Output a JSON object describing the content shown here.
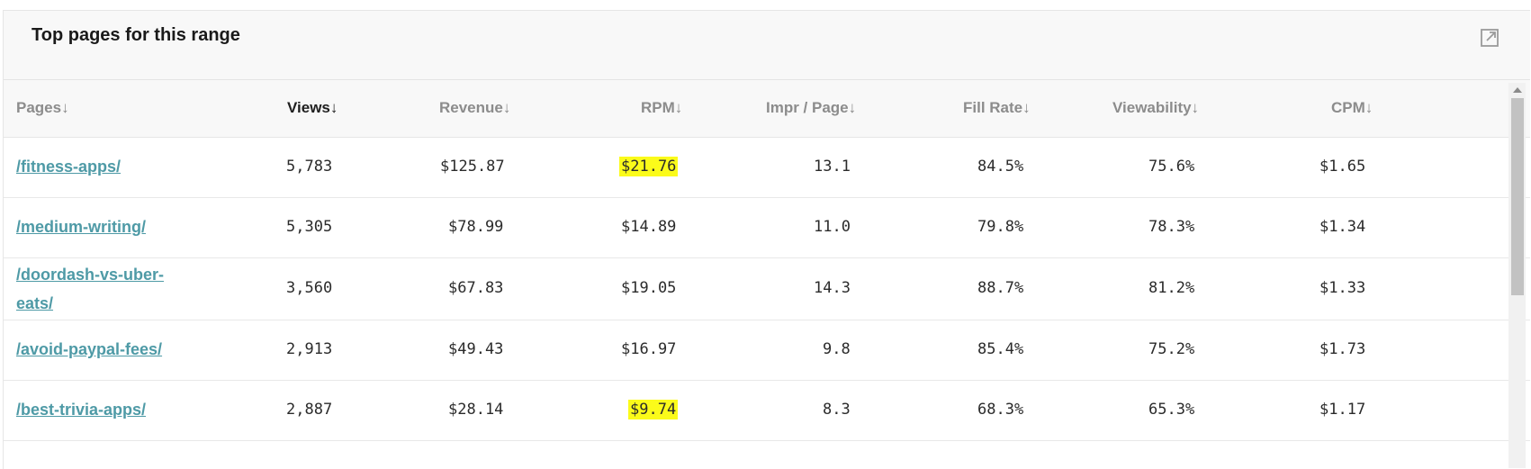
{
  "card": {
    "title": "Top pages for this range",
    "expand_icon": "external-link-icon"
  },
  "columns": [
    {
      "key": "pages",
      "label": "Pages↓",
      "active": false
    },
    {
      "key": "views",
      "label": "Views↓",
      "active": true
    },
    {
      "key": "revenue",
      "label": "Revenue↓",
      "active": false
    },
    {
      "key": "rpm",
      "label": "RPM↓",
      "active": false
    },
    {
      "key": "impr",
      "label": "Impr / Page↓",
      "active": false
    },
    {
      "key": "fill",
      "label": "Fill Rate↓",
      "active": false
    },
    {
      "key": "view",
      "label": "Viewability↓",
      "active": false
    },
    {
      "key": "cpm",
      "label": "CPM↓",
      "active": false
    }
  ],
  "rows": [
    {
      "page": "/fitness-apps/",
      "views": "5,783",
      "revenue": "$125.87",
      "rpm": "$21.76",
      "rpm_highlight": true,
      "impr": "13.1",
      "fill": "84.5%",
      "viewability": "75.6%",
      "cpm": "$1.65"
    },
    {
      "page": "/medium-writing/",
      "views": "5,305",
      "revenue": "$78.99",
      "rpm": "$14.89",
      "rpm_highlight": false,
      "impr": "11.0",
      "fill": "79.8%",
      "viewability": "78.3%",
      "cpm": "$1.34"
    },
    {
      "page": "/doordash-vs-uber-eats/",
      "views": "3,560",
      "revenue": "$67.83",
      "rpm": "$19.05",
      "rpm_highlight": false,
      "impr": "14.3",
      "fill": "88.7%",
      "viewability": "81.2%",
      "cpm": "$1.33"
    },
    {
      "page": "/avoid-paypal-fees/",
      "views": "2,913",
      "revenue": "$49.43",
      "rpm": "$16.97",
      "rpm_highlight": false,
      "impr": "9.8",
      "fill": "85.4%",
      "viewability": "75.2%",
      "cpm": "$1.73"
    },
    {
      "page": "/best-trivia-apps/",
      "views": "2,887",
      "revenue": "$28.14",
      "rpm": "$9.74",
      "rpm_highlight": true,
      "impr": "8.3",
      "fill": "68.3%",
      "viewability": "65.3%",
      "cpm": "$1.17"
    }
  ],
  "colors": {
    "highlight": "#fbfb1a",
    "link": "#4e9aa6"
  }
}
